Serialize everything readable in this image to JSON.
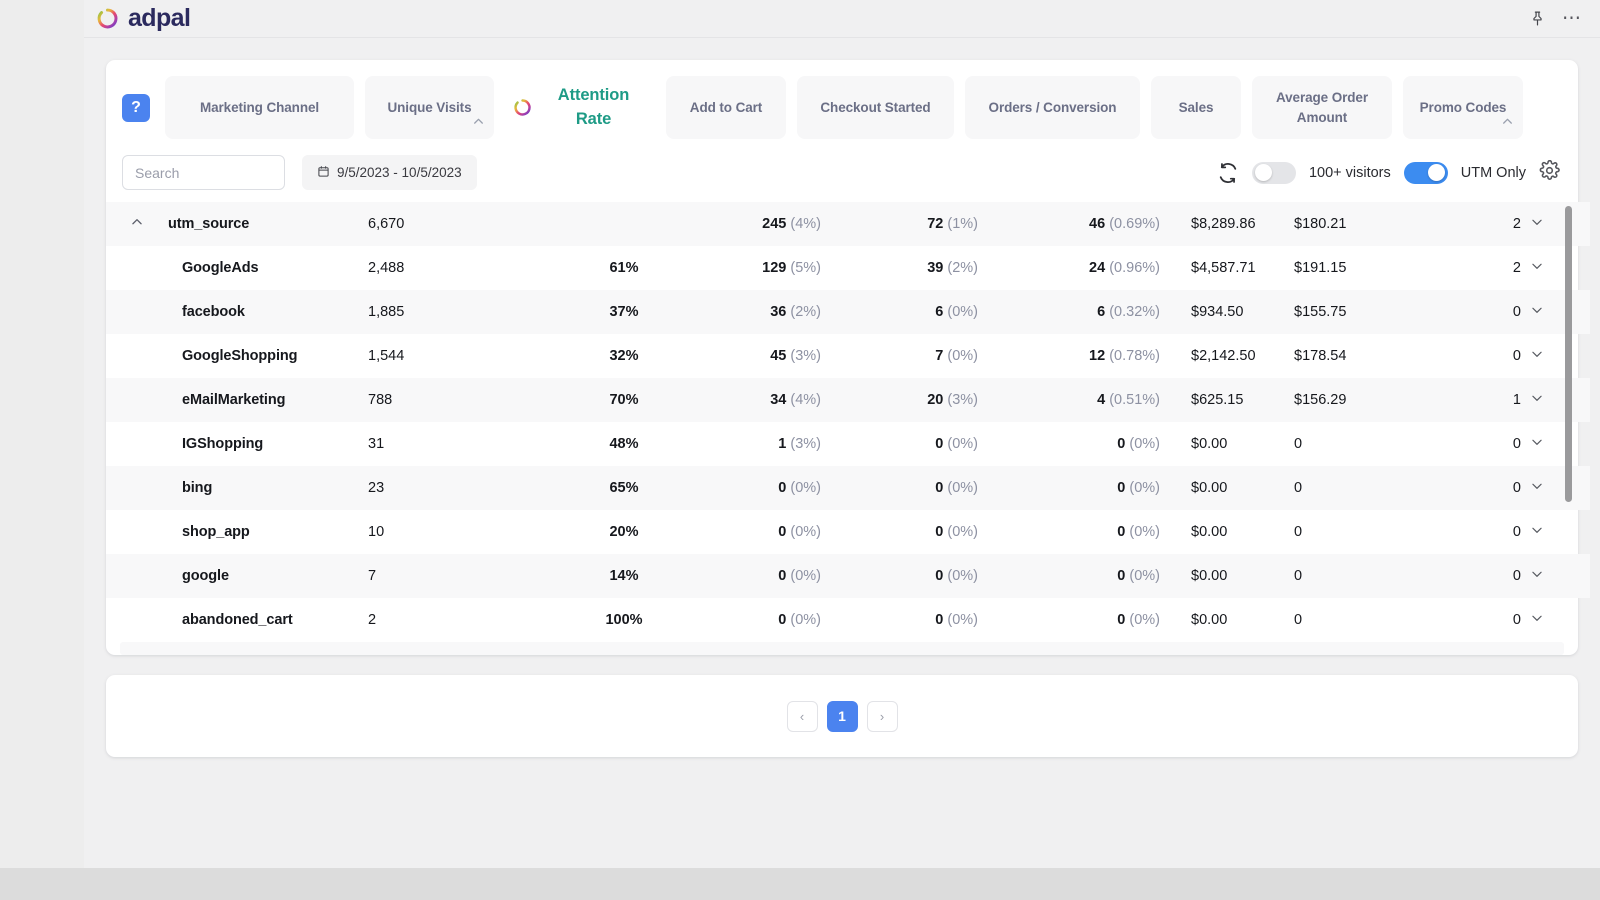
{
  "brand": {
    "name": "adpal",
    "logo_icon": "adpal-donut-logo"
  },
  "topbar": {
    "pin_icon": "pin-icon",
    "more_icon": "more-options-icon"
  },
  "columns": {
    "help_label": "?",
    "items": [
      {
        "label": "Marketing Channel",
        "active": false,
        "chevron": false
      },
      {
        "label": "Unique Visits",
        "active": false,
        "chevron": true
      },
      {
        "label": "Attention Rate",
        "active": true,
        "chevron": false
      },
      {
        "label": "Add to Cart",
        "active": false,
        "chevron": false
      },
      {
        "label": "Checkout Started",
        "active": false,
        "chevron": false
      },
      {
        "label": "Orders / Conversion",
        "active": false,
        "chevron": false
      },
      {
        "label": "Sales",
        "active": false,
        "chevron": false
      },
      {
        "label": "Average Order Amount",
        "active": false,
        "chevron": false
      },
      {
        "label": "Promo Codes",
        "active": false,
        "chevron": true
      }
    ]
  },
  "toolbar": {
    "search_placeholder": "Search",
    "search_value": "",
    "date_range": "9/5/2023 - 10/5/2023",
    "calendar_icon": "calendar-icon",
    "refresh_icon": "refresh-icon",
    "visitors_toggle": {
      "label": "100+ visitors",
      "on": false
    },
    "utm_toggle": {
      "label": "UTM Only",
      "on": true
    },
    "settings_icon": "gear-icon"
  },
  "table": {
    "rows": [
      {
        "name": "utm_source",
        "group": true,
        "expanded": true,
        "visits": "6,670",
        "rate": "",
        "rate_color": "",
        "add_to_cart": "245",
        "add_to_cart_pct": "(4%)",
        "checkout": "72",
        "checkout_pct": "(1%)",
        "orders": "46",
        "orders_pct": "(0.69%)",
        "sales": "$8,289.86",
        "aoa": "$180.21",
        "promo": "2"
      },
      {
        "name": "GoogleAds",
        "group": false,
        "visits": "2,488",
        "rate": "61%",
        "rate_color": "green",
        "add_to_cart": "129",
        "add_to_cart_pct": "(5%)",
        "checkout": "39",
        "checkout_pct": "(2%)",
        "orders": "24",
        "orders_pct": "(0.96%)",
        "sales": "$4,587.71",
        "aoa": "$191.15",
        "promo": "2"
      },
      {
        "name": "facebook",
        "group": false,
        "visits": "1,885",
        "rate": "37%",
        "rate_color": "blue",
        "add_to_cart": "36",
        "add_to_cart_pct": "(2%)",
        "checkout": "6",
        "checkout_pct": "(0%)",
        "orders": "6",
        "orders_pct": "(0.32%)",
        "sales": "$934.50",
        "aoa": "$155.75",
        "promo": "0"
      },
      {
        "name": "GoogleShopping",
        "group": false,
        "visits": "1,544",
        "rate": "32%",
        "rate_color": "blue",
        "add_to_cart": "45",
        "add_to_cart_pct": "(3%)",
        "checkout": "7",
        "checkout_pct": "(0%)",
        "orders": "12",
        "orders_pct": "(0.78%)",
        "sales": "$2,142.50",
        "aoa": "$178.54",
        "promo": "0"
      },
      {
        "name": "eMailMarketing",
        "group": false,
        "visits": "788",
        "rate": "70%",
        "rate_color": "green",
        "add_to_cart": "34",
        "add_to_cart_pct": "(4%)",
        "checkout": "20",
        "checkout_pct": "(3%)",
        "orders": "4",
        "orders_pct": "(0.51%)",
        "sales": "$625.15",
        "aoa": "$156.29",
        "promo": "1"
      },
      {
        "name": "IGShopping",
        "group": false,
        "visits": "31",
        "rate": "48%",
        "rate_color": "blue",
        "add_to_cart": "1",
        "add_to_cart_pct": "(3%)",
        "checkout": "0",
        "checkout_pct": "(0%)",
        "orders": "0",
        "orders_pct": "(0%)",
        "sales": "$0.00",
        "aoa": "0",
        "promo": "0"
      },
      {
        "name": "bing",
        "group": false,
        "visits": "23",
        "rate": "65%",
        "rate_color": "green",
        "add_to_cart": "0",
        "add_to_cart_pct": "(0%)",
        "checkout": "0",
        "checkout_pct": "(0%)",
        "orders": "0",
        "orders_pct": "(0%)",
        "sales": "$0.00",
        "aoa": "0",
        "promo": "0"
      },
      {
        "name": "shop_app",
        "group": false,
        "visits": "10",
        "rate": "20%",
        "rate_color": "red",
        "add_to_cart": "0",
        "add_to_cart_pct": "(0%)",
        "checkout": "0",
        "checkout_pct": "(0%)",
        "orders": "0",
        "orders_pct": "(0%)",
        "sales": "$0.00",
        "aoa": "0",
        "promo": "0"
      },
      {
        "name": "google",
        "group": false,
        "visits": "7",
        "rate": "14%",
        "rate_color": "red",
        "add_to_cart": "0",
        "add_to_cart_pct": "(0%)",
        "checkout": "0",
        "checkout_pct": "(0%)",
        "orders": "0",
        "orders_pct": "(0%)",
        "sales": "$0.00",
        "aoa": "0",
        "promo": "0"
      },
      {
        "name": "abandoned_cart",
        "group": false,
        "visits": "2",
        "rate": "100%",
        "rate_color": "green",
        "add_to_cart": "0",
        "add_to_cart_pct": "(0%)",
        "checkout": "0",
        "checkout_pct": "(0%)",
        "orders": "0",
        "orders_pct": "(0%)",
        "sales": "$0.00",
        "aoa": "0",
        "promo": "0"
      }
    ]
  },
  "pagination": {
    "prev": "‹",
    "next": "›",
    "pages": [
      "1"
    ],
    "current": "1"
  },
  "colors": {
    "accent_blue": "#4b83ef",
    "attention_teal": "#1e9b86",
    "rate_green": "#33b37f",
    "rate_blue": "#5b79e8",
    "rate_red": "#ef7b6b",
    "muted": "#8d91a2"
  }
}
